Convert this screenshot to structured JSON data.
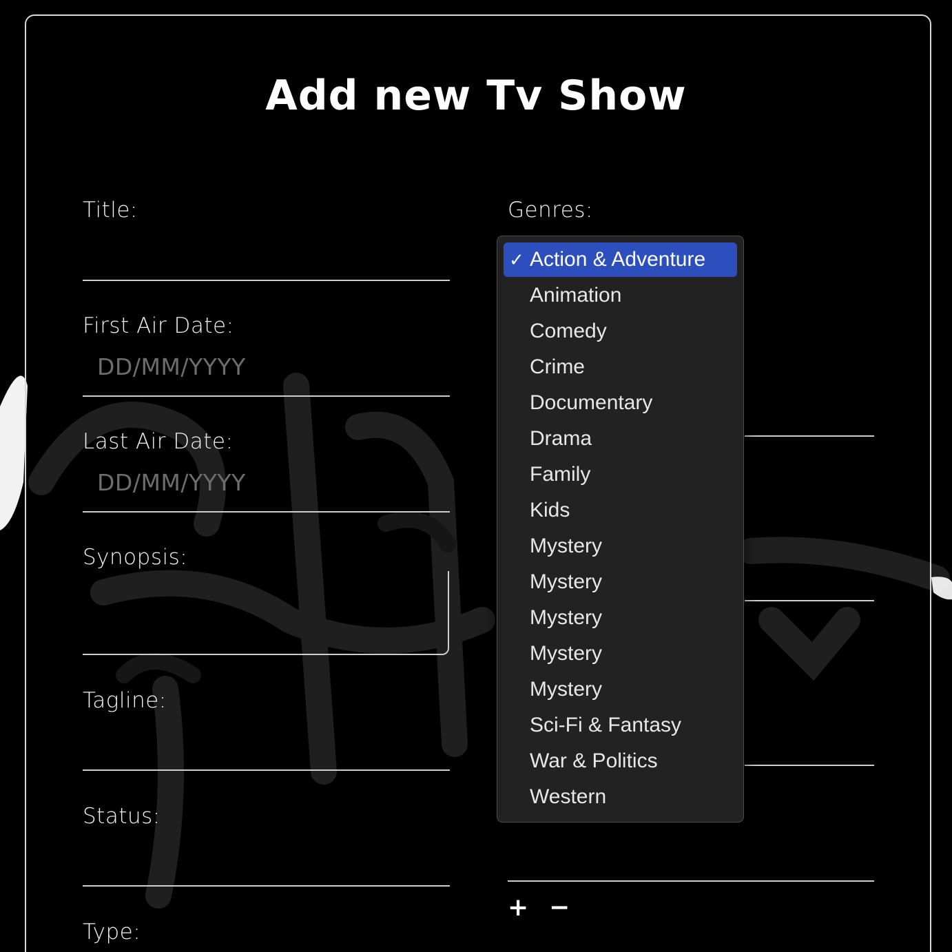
{
  "form": {
    "title": "Add new Tv Show"
  },
  "fields": {
    "title_label": "Title:",
    "first_air_date_label": "First Air Date:",
    "first_air_date_placeholder": "DD/MM/YYYY",
    "last_air_date_label": "Last Air Date:",
    "last_air_date_placeholder": "DD/MM/YYYY",
    "synopsis_label": "Synopsis:",
    "tagline_label": "Tagline:",
    "status_label": "Status:",
    "type_label": "Type:",
    "genres_label": "Genres:"
  },
  "genre_actions": {
    "add": "+",
    "remove": "−"
  },
  "genres_dropdown": {
    "check_mark": "✓",
    "selected": "Action & Adventure",
    "options": [
      "Action & Adventure",
      "Animation",
      "Comedy",
      "Crime",
      "Documentary",
      "Drama",
      "Family",
      "Kids",
      "Mystery",
      "Mystery",
      "Mystery",
      "Mystery",
      "Mystery",
      "Sci-Fi & Fantasy",
      "War & Politics",
      "Western"
    ]
  },
  "colors": {
    "background": "#000000",
    "dropdown_bg": "#222222",
    "selection": "#2c4fbd",
    "border": "#d8d8d8"
  }
}
